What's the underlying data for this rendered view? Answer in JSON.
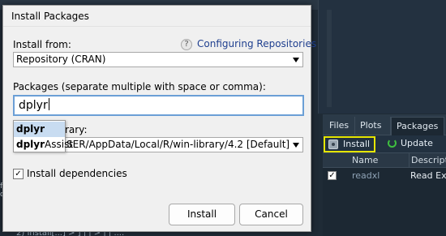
{
  "dialog": {
    "title": "Install Packages",
    "install_from_label": "Install from:",
    "help_icon": "?",
    "help_link": "Configuring Repositories",
    "install_from_value": "Repository (CRAN)",
    "packages_label": "Packages (separate multiple with space or comma):",
    "packages_value": "dplyr",
    "library_label_partial": "rary:",
    "library_value": "SER/AppData/Local/R/win-library/4.2 [Default]",
    "autocomplete": {
      "items": [
        {
          "bold": "dplyr",
          "rest": ""
        },
        {
          "bold": "dplyr",
          "rest": "Assist"
        }
      ]
    },
    "install_dependencies_label": "Install dependencies",
    "install_dependencies_checked": "✓",
    "install_button": "Install",
    "cancel_button": "Cancel"
  },
  "pane": {
    "tabs": [
      "Files",
      "Plots",
      "Packages"
    ],
    "toolbar": {
      "install": "Install",
      "update": "Update"
    },
    "columns": {
      "name": "Name",
      "description": "Descripti"
    },
    "rows": [
      {
        "checked": "✓",
        "name": "readxl",
        "description": "Read Exc"
      }
    ]
  },
  "ide": {
    "left_edge_chars": [
      "f",
      "d"
    ],
    "bottom_text": "2) Install[...] > ] | | > | | ...."
  }
}
